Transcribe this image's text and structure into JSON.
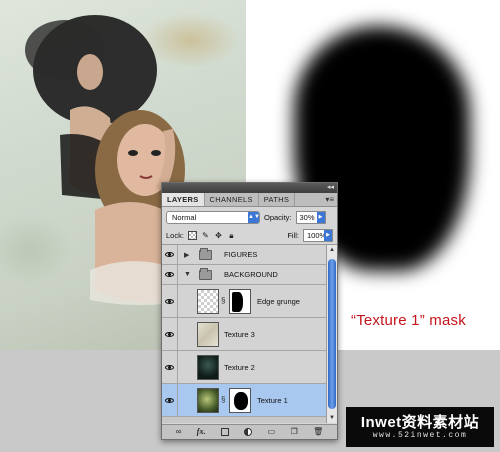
{
  "caption": "“Texture 1” mask",
  "watermark": {
    "title": "Inwet资料素材站",
    "url": "www.52inwet.com"
  },
  "panel": {
    "tabs": [
      {
        "label": "LAYERS",
        "active": true
      },
      {
        "label": "CHANNELS",
        "active": false
      },
      {
        "label": "PATHS",
        "active": false
      }
    ],
    "blend_mode": "Normal",
    "opacity_label": "Opacity:",
    "opacity_value": "30%",
    "lock_label": "Lock:",
    "fill_label": "Fill:",
    "fill_value": "100%",
    "layers": [
      {
        "name": "FIGURES",
        "type": "group",
        "expanded": false,
        "visible": true
      },
      {
        "name": "BACKGROUND",
        "type": "group",
        "expanded": true,
        "visible": true
      },
      {
        "name": "Edge grunge",
        "type": "masked",
        "visible": true,
        "selected": false
      },
      {
        "name": "Texture 3",
        "type": "layer",
        "visible": true,
        "selected": false
      },
      {
        "name": "Texture 2",
        "type": "layer",
        "visible": true,
        "selected": false
      },
      {
        "name": "Texture 1",
        "type": "masked",
        "visible": true,
        "selected": true
      }
    ],
    "bottom_icons": [
      "link-icon",
      "fx-icon",
      "add-mask-icon",
      "adjustment-layer-icon",
      "new-group-icon",
      "new-layer-icon",
      "trash-icon"
    ]
  },
  "colors": {
    "caption": "#c4141b",
    "selection": "#a8c8ef",
    "accent": "#3d77d6"
  }
}
